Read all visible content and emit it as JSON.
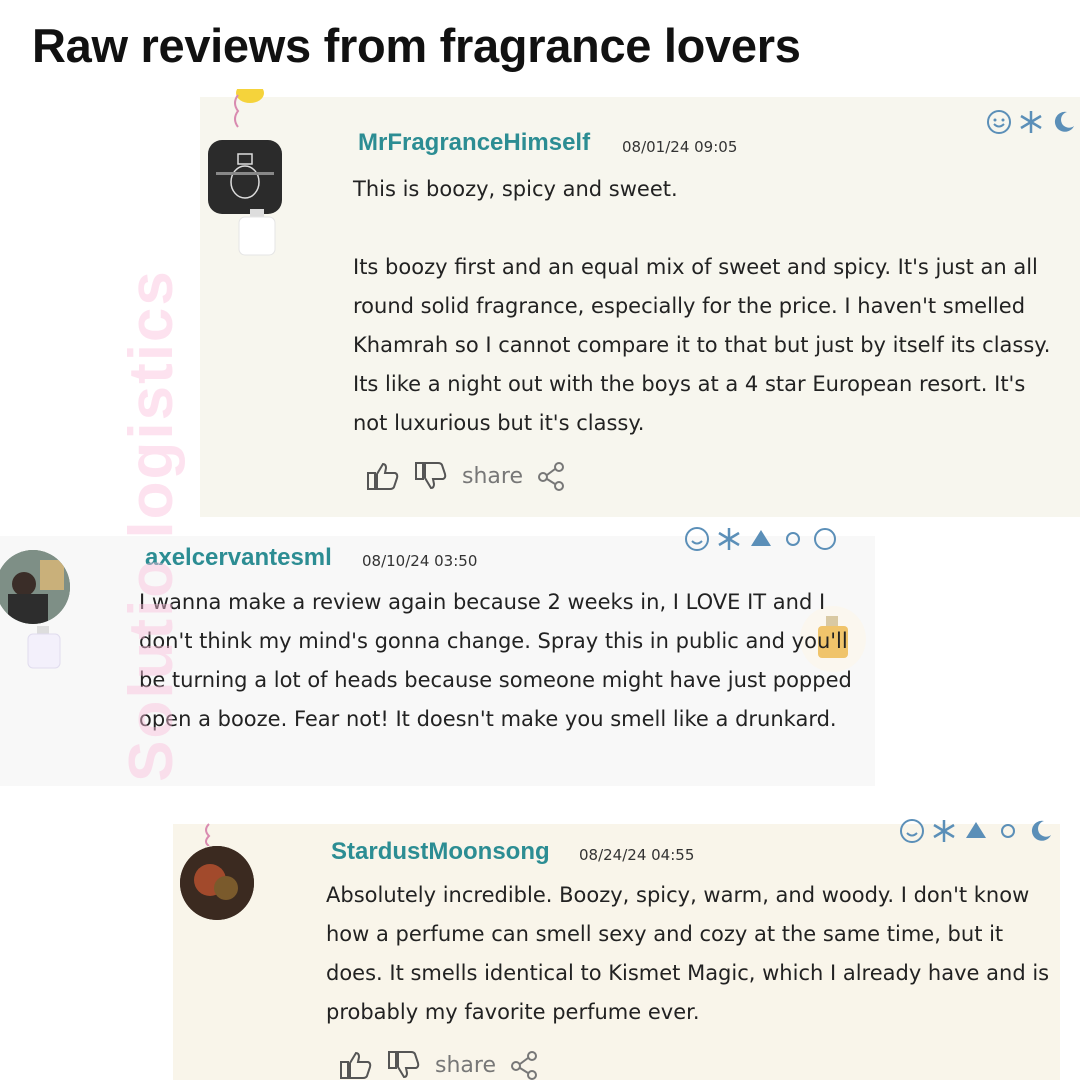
{
  "heading": "Raw reviews from fragrance lovers",
  "watermark": "Solutio logistics",
  "reviews": [
    {
      "username": "MrFragranceHimself",
      "timestamp": "08/01/24 09:05",
      "paragraphs": [
        "This is boozy, spicy and sweet.",
        "Its boozy first and an equal mix of sweet and spicy. It's just an all round solid fragrance, especially for the price. I haven't smelled Khamrah so I cannot compare it to that but just by itself its classy. Its like a night out with the boys at a 4 star European resort. It's not luxurious but it's classy."
      ],
      "share_label": "share"
    },
    {
      "username": "axelcervantesml",
      "timestamp": "08/10/24 03:50",
      "paragraphs": [
        "I wanna make a review again because 2 weeks in, I LOVE IT and I don't think my mind's gonna change. Spray this in public and you'll be turning a lot of heads because someone might have just popped open a booze. Fear not! It doesn't make you smell like a drunkard."
      ]
    },
    {
      "username": "StardustMoonsong",
      "timestamp": "08/24/24 04:55",
      "paragraphs": [
        "Absolutely incredible. Boozy, spicy, warm, and woody. I don't know how a perfume can smell sexy and cozy at the same time, but it does. It smells identical to Kismet Magic, which I already have and is probably my favorite perfume ever."
      ],
      "share_label": "share"
    }
  ],
  "colors": {
    "username": "#2c8d93",
    "mood_icons": "#5b8fb8",
    "card1_bg": "#f7f6ee",
    "card2_bg": "#f8f8f8",
    "card3_bg": "#f9f5ea"
  },
  "icons": [
    "thumbs-up-icon",
    "thumbs-down-icon",
    "share-icon",
    "smiley-icon",
    "snowflake-icon",
    "leaf-icon",
    "sun-icon",
    "moon-icon"
  ]
}
